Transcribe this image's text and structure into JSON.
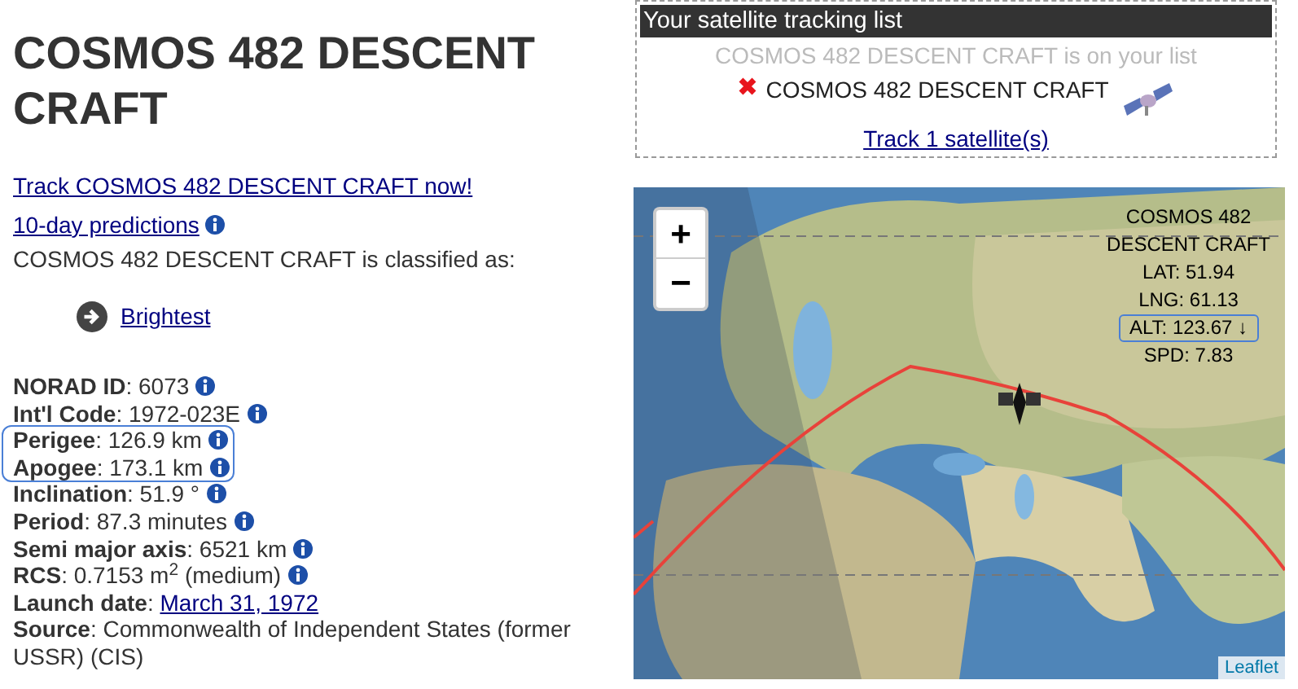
{
  "title": "COSMOS 482 DESCENT CRAFT",
  "track_link": "Track COSMOS 482 DESCENT CRAFT now!",
  "predictions_link": {
    "label": "10-day predictions",
    "info": true
  },
  "classified_text": "COSMOS 482 DESCENT CRAFT is classified as:",
  "categories": [
    {
      "label": "Brightest"
    }
  ],
  "facts": [
    {
      "text": "**NORAD ID**: 6073",
      "info": true,
      "highlighted": false
    },
    {
      "text": "**Int'l Code**: 1972-023E",
      "info": true,
      "highlighted": false
    },
    {
      "text": "**Perigee**: 126.9 km",
      "info": true,
      "highlighted": true
    },
    {
      "text": "**Apogee**: 173.1 km",
      "info": true,
      "highlighted": true
    },
    {
      "text": "**Inclination**: 51.9 °",
      "info": true,
      "highlighted": false
    },
    {
      "text": "**Period**: 87.3 minutes",
      "info": true,
      "highlighted": false
    },
    {
      "text": "**Semi major axis**: 6521 km",
      "info": true,
      "highlighted": false
    },
    {
      "text": "**RCS**: 0.7153 m$^{2}$ (medium)",
      "info": true,
      "highlighted": false
    },
    {
      "text": "**Launch date**:",
      "link": "March 31, 1972",
      "info": false,
      "highlighted": false
    },
    {
      "text": "**Source**: Commonwealth of Independent States (former USSR) (CIS)",
      "info": false,
      "highlighted": false
    }
  ],
  "tracking_list": {
    "title": "Your satellite tracking list",
    "notice": "COSMOS 482 DESCENT CRAFT is on your list",
    "items": [
      {
        "name": "COSMOS 482 DESCENT CRAFT"
      }
    ],
    "track_link": "Track 1 satellite(s)"
  },
  "map": {
    "kind": "picture",
    "zoom_buttons": [
      "+",
      "−"
    ],
    "info_lines": [
      {
        "text": "COSMOS 482",
        "highlighted": false
      },
      {
        "text": "DESCENT CRAFT",
        "highlighted": false
      },
      {
        "text": "LAT: 51.94",
        "highlighted": false
      },
      {
        "text": "LNG: 61.13",
        "highlighted": false
      },
      {
        "text": "ALT: 123.67 ↓",
        "highlighted": true
      },
      {
        "text": "SPD: 7.83",
        "highlighted": false
      }
    ],
    "attribution": "Leaflet"
  }
}
